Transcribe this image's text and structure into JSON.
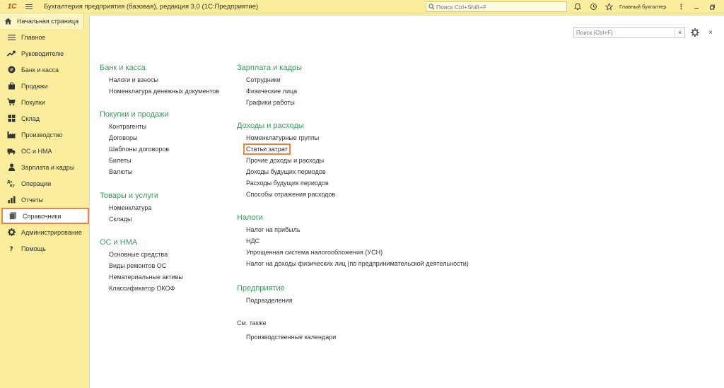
{
  "titlebar": {
    "logo": "1С",
    "title": "Бухгалтерия предприятия (базовая), редакция 3.0  (1С:Предприятие)",
    "search_placeholder": "Поиск Ctrl+Shift+F",
    "user": "Главный бухгалтер"
  },
  "home_tab": {
    "label": "Начальная страница"
  },
  "sidebar": {
    "items": [
      {
        "label": "Главное",
        "icon": "menu-lines-icon"
      },
      {
        "label": "Руководителю",
        "icon": "trend-icon"
      },
      {
        "label": "Банк и касса",
        "icon": "coin-icon"
      },
      {
        "label": "Продажи",
        "icon": "shopping-bag-icon"
      },
      {
        "label": "Покупки",
        "icon": "cart-icon"
      },
      {
        "label": "Склад",
        "icon": "warehouse-icon"
      },
      {
        "label": "Производство",
        "icon": "factory-icon"
      },
      {
        "label": "ОС и НМА",
        "icon": "truck-icon"
      },
      {
        "label": "Зарплата и кадры",
        "icon": "person-icon"
      },
      {
        "label": "Операции",
        "icon": "dt-kt-icon"
      },
      {
        "label": "Отчеты",
        "icon": "bar-chart-icon"
      },
      {
        "label": "Справочники",
        "icon": "book-icon",
        "active": true
      },
      {
        "label": "Администрирование",
        "icon": "gear-icon"
      },
      {
        "label": "Помощь",
        "icon": "question-icon"
      }
    ]
  },
  "content": {
    "search_placeholder": "Поиск (Ctrl+F)",
    "left_column": [
      {
        "title": "Банк и касса",
        "links": [
          "Налоги и взносы",
          "Номенклатура денежных документов"
        ]
      },
      {
        "title": "Покупки и продажи",
        "links": [
          "Контрагенты",
          "Договоры",
          "Шаблоны договоров",
          "Билеты",
          "Валюты"
        ]
      },
      {
        "title": "Товары и услуги",
        "links": [
          "Номенклатура",
          "Склады"
        ]
      },
      {
        "title": "ОС и НМА",
        "links": [
          "Основные средства",
          "Виды ремонтов ОС",
          "Нематериальные активы",
          "Классификатор ОКОФ"
        ]
      }
    ],
    "right_column": [
      {
        "title": "Зарплата и кадры",
        "links": [
          "Сотрудники",
          "Физические лица",
          "Графики работы"
        ]
      },
      {
        "title": "Доходы и расходы",
        "links": [
          "Номенклатурные группы",
          "Статьи затрат",
          "Прочие доходы и расходы",
          "Доходы будущих периодов",
          "Расходы будущих периодов",
          "Способы отражения расходов"
        ]
      },
      {
        "title": "Налоги",
        "links": [
          "Налог на прибыль",
          "НДС",
          "Упрощенная система налогообложения (УСН)",
          "Налог на доходы физических лиц (по предпринимательской деятельности)"
        ]
      },
      {
        "title": "Предприятие",
        "links": [
          "Подразделения"
        ]
      },
      {
        "title": "См. также",
        "links": [
          "Производственные календари"
        ]
      }
    ]
  },
  "colors": {
    "sidebar_bg": "#fbed9e",
    "group_title": "#3a9d5d",
    "highlight": "#f0843c"
  }
}
